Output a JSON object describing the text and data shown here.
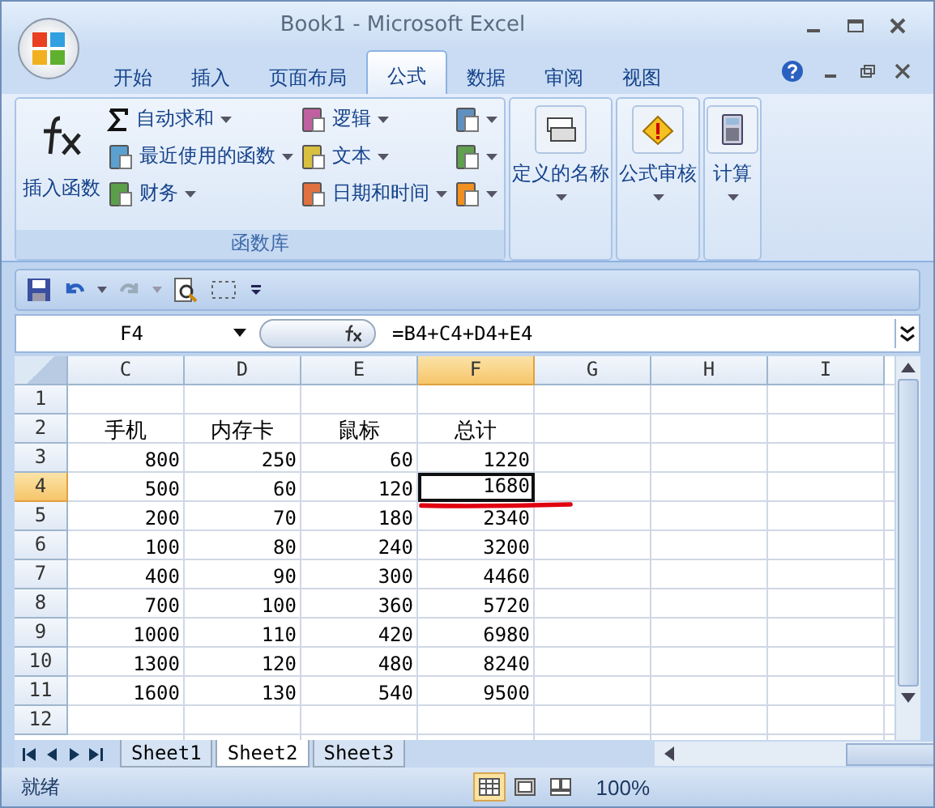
{
  "window": {
    "title": "Book1 - Microsoft Excel"
  },
  "tabs": [
    {
      "label": "开始",
      "selected": false
    },
    {
      "label": "插入",
      "selected": false
    },
    {
      "label": "页面布局",
      "selected": false
    },
    {
      "label": "公式",
      "selected": true
    },
    {
      "label": "数据",
      "selected": false
    },
    {
      "label": "审阅",
      "selected": false
    },
    {
      "label": "视图",
      "selected": false
    }
  ],
  "ribbon": {
    "function_library": {
      "label": "函数库",
      "insert_function": "插入函数",
      "commands": [
        {
          "label": "自动求和",
          "kind": "sigma"
        },
        {
          "label": "最近使用的函数",
          "kind": "book"
        },
        {
          "label": "财务",
          "kind": "book"
        },
        {
          "label": "逻辑",
          "kind": "book"
        },
        {
          "label": "文本",
          "kind": "book"
        },
        {
          "label": "日期和时间",
          "kind": "book"
        }
      ],
      "icon_menus": [
        {
          "kind": "book"
        },
        {
          "kind": "book"
        },
        {
          "kind": "book"
        }
      ]
    },
    "big_buttons": [
      {
        "label": "定义的名称",
        "kind": "names"
      },
      {
        "label": "公式审核",
        "kind": "audit"
      },
      {
        "label": "计算",
        "kind": "calculator"
      }
    ]
  },
  "formula_bar": {
    "name_box": "F4",
    "formula": "=B4+C4+D4+E4"
  },
  "columns": [
    {
      "label": "C",
      "selected": false
    },
    {
      "label": "D",
      "selected": false
    },
    {
      "label": "E",
      "selected": false
    },
    {
      "label": "F",
      "selected": true
    },
    {
      "label": "G",
      "selected": false
    },
    {
      "label": "H",
      "selected": false
    },
    {
      "label": "I",
      "selected": false
    }
  ],
  "rows": [
    {
      "number": "1",
      "selected": false
    },
    {
      "number": "2",
      "selected": false,
      "kind": "labels",
      "values": [
        "手机",
        "内存卡",
        "鼠标",
        "总计"
      ]
    },
    {
      "number": "3",
      "selected": false,
      "kind": "numbers",
      "values": [
        "800",
        "250",
        "60",
        "1220"
      ]
    },
    {
      "number": "4",
      "selected": true,
      "kind": "numbers",
      "values": [
        "500",
        "60",
        "120",
        "1680"
      ]
    },
    {
      "number": "5",
      "selected": false,
      "kind": "numbers",
      "values": [
        "200",
        "70",
        "180",
        "2340"
      ]
    },
    {
      "number": "6",
      "selected": false,
      "kind": "numbers",
      "values": [
        "100",
        "80",
        "240",
        "3200"
      ]
    },
    {
      "number": "7",
      "selected": false,
      "kind": "numbers",
      "values": [
        "400",
        "90",
        "300",
        "4460"
      ]
    },
    {
      "number": "8",
      "selected": false,
      "kind": "numbers",
      "values": [
        "700",
        "100",
        "360",
        "5720"
      ]
    },
    {
      "number": "9",
      "selected": false,
      "kind": "numbers",
      "values": [
        "1000",
        "110",
        "420",
        "6980"
      ]
    },
    {
      "number": "10",
      "selected": false,
      "kind": "numbers",
      "values": [
        "1300",
        "120",
        "480",
        "8240"
      ]
    },
    {
      "number": "11",
      "selected": false,
      "kind": "numbers",
      "values": [
        "1600",
        "130",
        "540",
        "9500"
      ]
    },
    {
      "number": "12",
      "selected": false
    }
  ],
  "sheet_tabs": [
    {
      "label": "Sheet1",
      "selected": false
    },
    {
      "label": "Sheet2",
      "selected": true
    },
    {
      "label": "Sheet3",
      "selected": false
    }
  ],
  "status_bar": {
    "status": "就绪",
    "views": [
      {
        "kind": "normal",
        "selected": true
      },
      {
        "kind": "layout",
        "selected": false
      },
      {
        "kind": "pagebreak",
        "selected": false
      }
    ],
    "zoom": "100%"
  }
}
